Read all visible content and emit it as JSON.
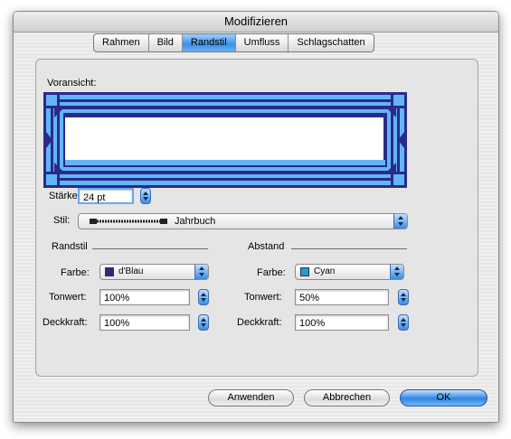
{
  "window": {
    "title": "Modifizieren"
  },
  "tabs": [
    {
      "label": "Rahmen",
      "active": false
    },
    {
      "label": "Bild",
      "active": false
    },
    {
      "label": "Randstil",
      "active": true
    },
    {
      "label": "Umfluss",
      "active": false
    },
    {
      "label": "Schlagschatten",
      "active": false
    }
  ],
  "preview": {
    "label": "Voransicht:",
    "colors": {
      "frame": "#2a2a8c",
      "fill": "#62b6f3",
      "inner": "#ffffff"
    }
  },
  "staerke": {
    "label": "Stärke:",
    "value": "24 pt"
  },
  "stil": {
    "label": "Stil:",
    "value": "Jahrbuch"
  },
  "randstil": {
    "heading": "Randstil",
    "farbe_label": "Farbe:",
    "farbe_value": "d'Blau",
    "farbe_swatch": "#2a2a7a",
    "tonwert_label": "Tonwert:",
    "tonwert_value": "100%",
    "deckkraft_label": "Deckkraft:",
    "deckkraft_value": "100%"
  },
  "abstand": {
    "heading": "Abstand",
    "farbe_label": "Farbe:",
    "farbe_value": "Cyan",
    "farbe_swatch": "#1e9be0",
    "tonwert_label": "Tonwert:",
    "tonwert_value": "50%",
    "deckkraft_label": "Deckkraft:",
    "deckkraft_value": "100%"
  },
  "buttons": {
    "apply": "Anwenden",
    "cancel": "Abbrechen",
    "ok": "OK"
  }
}
